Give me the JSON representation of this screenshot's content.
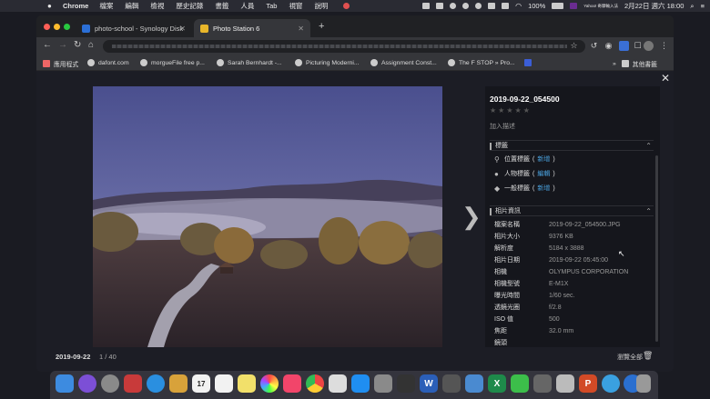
{
  "menubar": {
    "apple": "",
    "app_name": "Chrome",
    "items": [
      "檔案",
      "編輯",
      "檢視",
      "歷史記錄",
      "書籤",
      "人員",
      "Tab",
      "視窗",
      "說明"
    ],
    "battery": "100%",
    "yahoo_label": "Yahoo! 奇摩輸入法",
    "datetime": "2月22日 週六  18:00"
  },
  "browser": {
    "tabs": [
      {
        "title": "photo-school - Synology Disk",
        "favicon_color": "#2b6fd6"
      },
      {
        "title": "Photo Station 6",
        "favicon_color": "#e8b62a"
      }
    ],
    "new_tab": "+",
    "bookmarks": [
      {
        "label": "應用程式"
      },
      {
        "label": "dafont.com"
      },
      {
        "label": "morgueFile free p..."
      },
      {
        "label": "Sarah Bernhardt -..."
      },
      {
        "label": "Picturing Moderni..."
      },
      {
        "label": "Assignment Const..."
      },
      {
        "label": "The F STOP » Pro..."
      },
      {
        "label": ""
      }
    ],
    "other_bookmarks": "其他書籤",
    "more": "»"
  },
  "viewer": {
    "close": "✕",
    "next": "❯",
    "footer_date": "2019-09-22",
    "footer_count": "1 / 40",
    "browse_all": "瀏覽全部",
    "panel": {
      "title": "2019-09-22_054500",
      "stars": "★★★★★",
      "rating": 0,
      "add_description": "加入描述",
      "tags_section": "標籤",
      "tags": [
        {
          "icon": "location-icon",
          "label": "位置標籤",
          "action": "新增"
        },
        {
          "icon": "person-icon",
          "label": "人物標籤",
          "action": "編輯"
        },
        {
          "icon": "tag-icon",
          "label": "一般標籤",
          "action": "新增"
        }
      ],
      "info_section": "相片資訊",
      "info": [
        {
          "k": "檔案名稱",
          "v": "2019-09-22_054500.JPG"
        },
        {
          "k": "相片大小",
          "v": "9376 KB"
        },
        {
          "k": "解析度",
          "v": "5184 x 3888"
        },
        {
          "k": "相片日期",
          "v": "2019-09-22 05:45:00"
        },
        {
          "k": "相機",
          "v": "OLYMPUS CORPORATION"
        },
        {
          "k": "相機型號",
          "v": "E-M1X"
        },
        {
          "k": "曝光時間",
          "v": "1/60 sec."
        },
        {
          "k": "透鏡光圈",
          "v": "f/2.8"
        },
        {
          "k": "ISO 值",
          "v": "500"
        },
        {
          "k": "焦距",
          "v": "32.0 mm"
        },
        {
          "k": "鏡頭",
          "v": ""
        }
      ]
    }
  },
  "dock": [
    "Finder",
    "Siri",
    "Launchpad",
    "Photo Booth",
    "Safari",
    "Notes",
    "Calendar",
    "Reminders",
    "Notes",
    "Photos",
    "Music",
    "Chrome",
    "Preview",
    "App Store",
    "System Preferences",
    "Camera",
    "Word",
    "Screenshot",
    "Image Capture",
    "Excel",
    "WeChat",
    "Screen Share",
    "Preview",
    "PowerPoint",
    "Facetime",
    "Safari",
    "Folder",
    "Trash"
  ],
  "colors": {
    "accent_link": "#4aa3e0",
    "panel_bg": "#15161c",
    "viewer_bg": "#1c1d25"
  }
}
